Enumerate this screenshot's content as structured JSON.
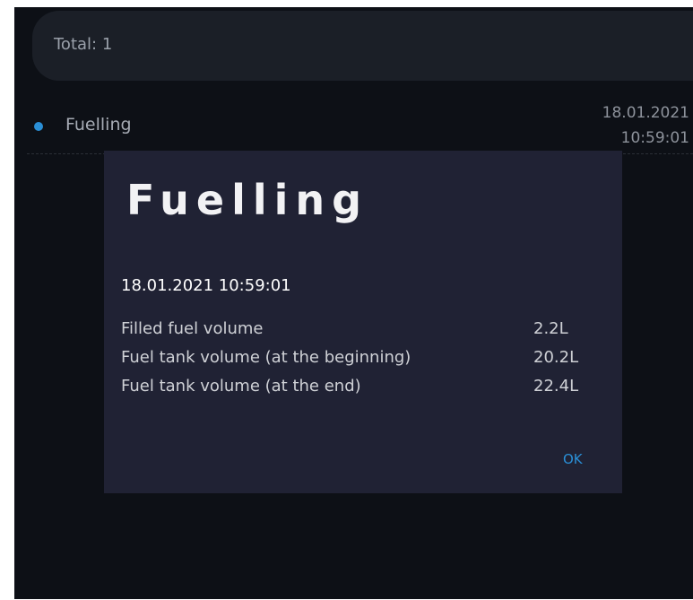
{
  "summary": {
    "total": "Total: 1"
  },
  "list": {
    "items": [
      {
        "title": "Fuelling",
        "date": "18.01.2021",
        "time": "10:59:01"
      }
    ]
  },
  "dialog": {
    "title": "Fuelling",
    "datetime": "18.01.2021 10:59:01",
    "rows": [
      {
        "label": "Filled fuel volume",
        "value": "2.2L"
      },
      {
        "label": "Fuel tank volume (at the beginning)",
        "value": "20.2L"
      },
      {
        "label": "Fuel tank volume (at the end)",
        "value": "22.4L"
      }
    ],
    "ok_label": "OK"
  },
  "colors": {
    "accent": "#2a8fd6",
    "background": "#0d1016",
    "dialog_background": "#202234"
  }
}
